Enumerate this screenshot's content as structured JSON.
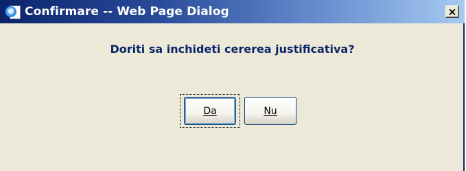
{
  "window": {
    "title": "Confirmare -- Web Page Dialog",
    "close_icon": "close-icon",
    "app_icon": "ie-page-icon"
  },
  "dialog": {
    "question": "Doriti sa inchideti cererea justificativa?",
    "buttons": {
      "yes_label": "Da",
      "no_label": "Nu",
      "focused": "Da"
    }
  },
  "colors": {
    "titlebar_start": "#0a246a",
    "titlebar_end": "#a6caf0",
    "dialog_bg": "#ece9d8",
    "question_text": "#0a246a"
  }
}
